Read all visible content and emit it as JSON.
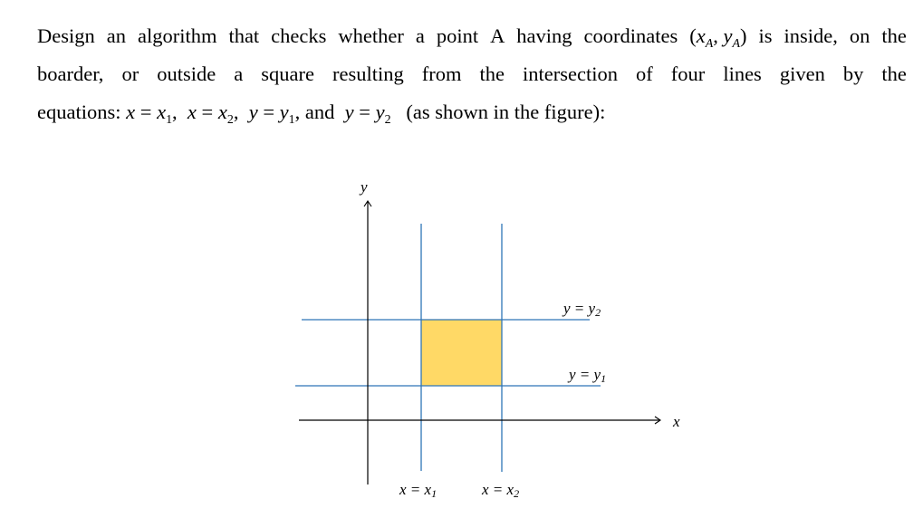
{
  "problem": {
    "line1_words": [
      "Design",
      "an",
      "algorithm",
      "that",
      "checks",
      "whether",
      "a",
      "point",
      "A",
      "having",
      "coordinates"
    ],
    "coord_open": "(",
    "coord_xa": "x",
    "coord_xa_sub": "A",
    "coord_sep": ",",
    "coord_ya": "y",
    "coord_ya_sub": "A",
    "coord_close": ")",
    "line1_tail": [
      "is",
      "inside,",
      "on",
      "the"
    ],
    "line2_words": [
      "boarder,",
      "or",
      "outside",
      "a",
      "square",
      "resulting",
      "from",
      "the",
      "intersection",
      "of",
      "four",
      "lines",
      "given",
      "by",
      "the"
    ],
    "line3_prefix": "equations:",
    "eq1": {
      "lhs": "x",
      "op": "=",
      "rhs": "x",
      "sub": "1"
    },
    "eq2": {
      "lhs": "x",
      "op": "=",
      "rhs": "x",
      "sub": "2"
    },
    "eq3": {
      "lhs": "y",
      "op": "=",
      "rhs": "y",
      "sub": "1"
    },
    "and_word": "and",
    "eq4": {
      "lhs": "y",
      "op": "=",
      "rhs": "y",
      "sub": "2"
    },
    "comma": ",",
    "line3_suffix": "(as shown in the figure):"
  },
  "figure": {
    "x_axis_label": "x",
    "y_axis_label": "y",
    "line_x1_label": {
      "lhs": "x = x",
      "sub": "1"
    },
    "line_x2_label": {
      "lhs": "x = x",
      "sub": "2"
    },
    "line_y1_label": {
      "lhs": "y = y",
      "sub": "1"
    },
    "line_y2_label": {
      "lhs": "y = y",
      "sub": "2"
    },
    "colors": {
      "boundary_lines": "#2e75b6",
      "square_fill": "#ffd966",
      "axes": "#000000"
    }
  }
}
